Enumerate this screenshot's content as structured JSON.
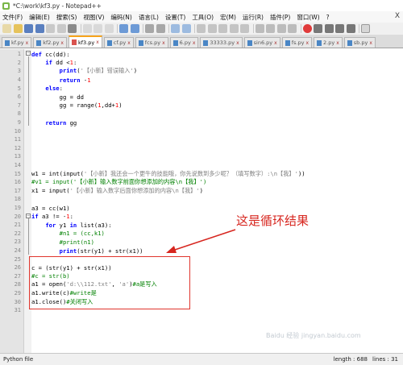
{
  "window": {
    "title": "*C:\\work\\kf3.py - Notepad++"
  },
  "menu": {
    "items": [
      "文件(F)",
      "编辑(E)",
      "搜索(S)",
      "视图(V)",
      "编码(N)",
      "语言(L)",
      "设置(T)",
      "工具(O)",
      "宏(M)",
      "运行(R)",
      "插件(P)",
      "窗口(W)",
      "?"
    ],
    "close": "X"
  },
  "tabs": [
    {
      "label": "kf.py",
      "active": false,
      "color": "blue"
    },
    {
      "label": "kf2.py",
      "active": false,
      "color": "blue"
    },
    {
      "label": "kf3.py",
      "active": true,
      "color": "red"
    },
    {
      "label": "cf.py",
      "active": false,
      "color": "blue"
    },
    {
      "label": "fcs.py",
      "active": false,
      "color": "blue"
    },
    {
      "label": "6.py",
      "active": false,
      "color": "blue"
    },
    {
      "label": "33333.py",
      "active": false,
      "color": "blue"
    },
    {
      "label": "sin6.py",
      "active": false,
      "color": "blue"
    },
    {
      "label": "fs.py",
      "active": false,
      "color": "blue"
    },
    {
      "label": "2.py",
      "active": false,
      "color": "blue"
    },
    {
      "label": "sb.py",
      "active": false,
      "color": "blue"
    }
  ],
  "code_lines": [
    {
      "n": "1",
      "html": "<span class=\"kw\">def</span> cc(dd):"
    },
    {
      "n": "2",
      "html": "    <span class=\"kw\">if</span> dd &lt;<span class=\"num\">1</span>:"
    },
    {
      "n": "3",
      "html": "        <span class=\"kw\">print</span>(<span class=\"str\">'【小新】错误输入'</span>)"
    },
    {
      "n": "4",
      "html": "        <span class=\"kw\">return</span> -<span class=\"num\">1</span>"
    },
    {
      "n": "5",
      "html": "    <span class=\"kw\">else</span>:"
    },
    {
      "n": "6",
      "html": "        gg = dd"
    },
    {
      "n": "7",
      "html": "        gg = range(<span class=\"num\">1</span>,dd+<span class=\"num\">1</span>)"
    },
    {
      "n": "8",
      "html": ""
    },
    {
      "n": "9",
      "html": "    <span class=\"kw\">return</span> gg"
    },
    {
      "n": "10",
      "html": ""
    },
    {
      "n": "11",
      "html": ""
    },
    {
      "n": "12",
      "html": ""
    },
    {
      "n": "13",
      "html": ""
    },
    {
      "n": "14",
      "html": ""
    },
    {
      "n": "15",
      "html": "w1 = int(input(<span class=\"str\">'【小新】我还会一个更牛的技能哦，你先说数到多少呢？（填写数字）:\\n【我】'</span>))"
    },
    {
      "n": "16",
      "html": "<span class=\"cmt\">#v1 = input('【小新】输入数字前面你想添加的内容\\n【我】')</span>"
    },
    {
      "n": "17",
      "html": "x1 = input(<span class=\"str\">'【小新】输入数字后面你想添加的内容\\n【我】'</span>)"
    },
    {
      "n": "18",
      "html": ""
    },
    {
      "n": "19",
      "html": "a3 = cc(w1)"
    },
    {
      "n": "20",
      "html": "<span class=\"kw\">if</span> a3 != -<span class=\"num\">1</span>:"
    },
    {
      "n": "21",
      "html": "    <span class=\"kw\">for</span> y1 <span class=\"kw\">in</span> list(a3):"
    },
    {
      "n": "22",
      "html": "        <span class=\"cmt\">#n1 = (cc,k1)</span>"
    },
    {
      "n": "23",
      "html": "        <span class=\"cmt\">#print(n1)</span>"
    },
    {
      "n": "24",
      "html": "        <span class=\"kw\">print</span>(str(y1) + str(x1))"
    },
    {
      "n": "25",
      "html": ""
    },
    {
      "n": "26",
      "html": "c = (str(y1) + str(x1))"
    },
    {
      "n": "27",
      "html": "<span class=\"cmt\">#c = str(b)</span>"
    },
    {
      "n": "28",
      "html": "a1 = open(<span class=\"str\">'d:\\\\112.txt'</span>, <span class=\"str\">'a'</span>)<span class=\"cmt\">#a是写入</span>"
    },
    {
      "n": "29",
      "html": "a1.write(c)<span class=\"cmt\">#write是</span>"
    },
    {
      "n": "30",
      "html": "a1.close()<span class=\"cmt\">#关闭写入</span>"
    },
    {
      "n": "31",
      "html": ""
    }
  ],
  "annotation": {
    "label": "这是循环结果"
  },
  "statusbar": {
    "language": "Python file",
    "length": "length : 688",
    "lines": "lines : 31"
  },
  "watermark": "Baidu 经验 jingyan.baidu.com",
  "colors": {
    "keyword": "#0000ff",
    "string": "#808080",
    "number": "#ff0000",
    "comment": "#008000",
    "annotation": "#d7261f",
    "active_tab_accent": "#f7a31c"
  }
}
